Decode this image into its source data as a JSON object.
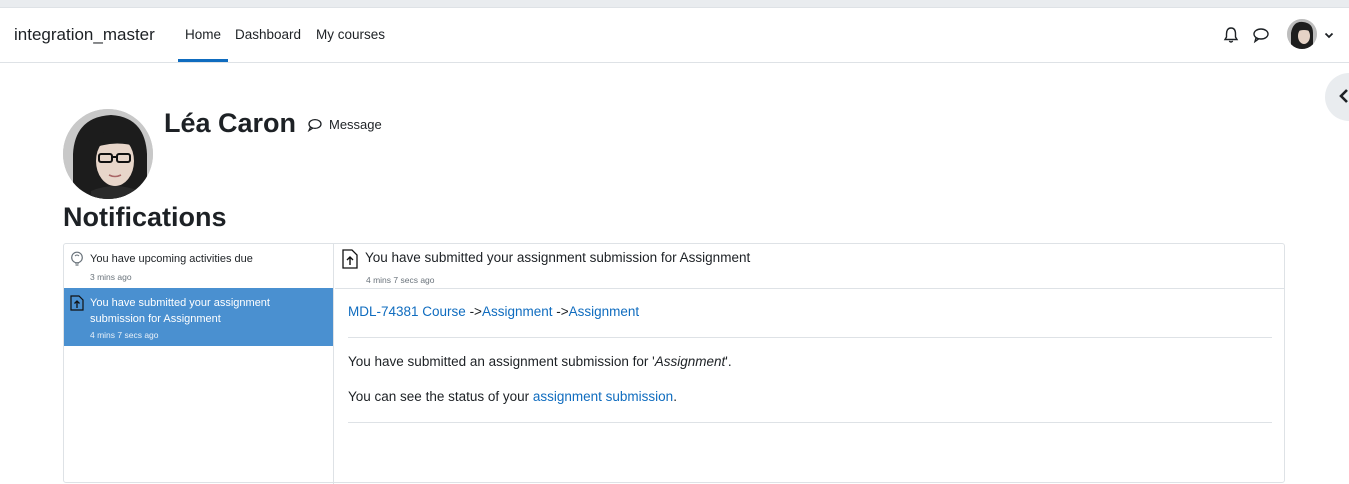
{
  "navbar": {
    "site_name": "integration_master",
    "links": [
      {
        "label": "Home",
        "active": true
      },
      {
        "label": "Dashboard",
        "active": false
      },
      {
        "label": "My courses",
        "active": false
      }
    ],
    "icons": [
      "bell-icon",
      "chat-icon",
      "user-avatar",
      "chevron-down-icon"
    ]
  },
  "profile": {
    "name": "Léa Caron",
    "message_label": "Message"
  },
  "page": {
    "title": "Notifications"
  },
  "notifications": [
    {
      "icon": "lightbulb-icon",
      "text": "You have upcoming activities due",
      "time": "3 mins ago",
      "selected": false
    },
    {
      "icon": "assignment-upload-icon",
      "text": "You have submitted your assignment submission for Assignment",
      "time": "4 mins 7 secs ago",
      "selected": true
    }
  ],
  "detail": {
    "subject": "You have submitted your assignment submission for Assignment",
    "time": "4 mins 7 secs ago",
    "breadcrumb": {
      "course": "MDL-74381 Course",
      "sep1": " ->",
      "module": "Assignment",
      "sep2": " ->",
      "item": "Assignment"
    },
    "line1_prefix": "You have submitted an assignment submission for '",
    "line1_em": "Assignment",
    "line1_suffix": "'.",
    "line2_prefix": "You can see the status of your ",
    "line2_link": "assignment submission",
    "line2_suffix": "."
  },
  "colors": {
    "accent": "#0f6cbf",
    "selected_bg": "#4a90d0",
    "border": "#dee2e6"
  }
}
